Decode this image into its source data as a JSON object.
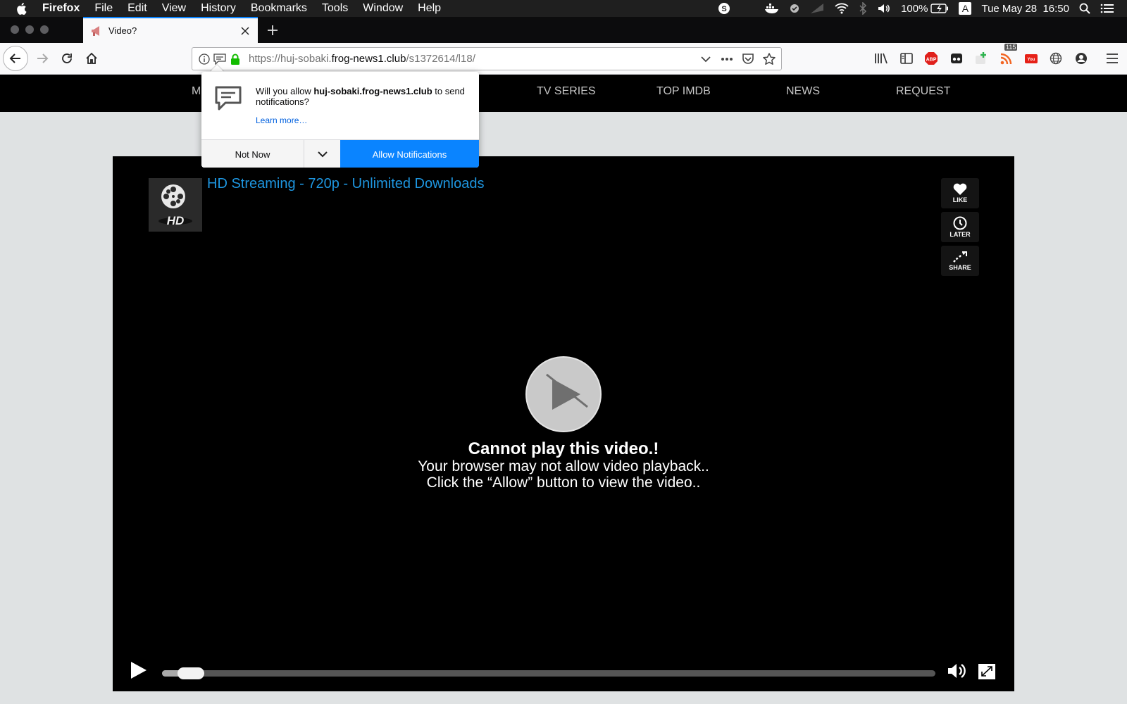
{
  "menubar": {
    "app": "Firefox",
    "items": [
      "File",
      "Edit",
      "View",
      "History",
      "Bookmarks",
      "Tools",
      "Window",
      "Help"
    ],
    "battery": "100%",
    "input_source": "A",
    "datetime": "Tue May 28  16:50"
  },
  "tab": {
    "title": "Video?"
  },
  "urlbar": {
    "url_prefix": "https://huj-sobaki.",
    "url_domain": "frog-news1.club",
    "url_suffix": "/s1372614/l18/"
  },
  "toolbar": {
    "rss_badge": "115"
  },
  "sitenav": {
    "partial_left": "M",
    "links": [
      "TV SERIES",
      "TOP IMDB",
      "NEWS",
      "REQUEST"
    ]
  },
  "popup": {
    "text_before": "Will you allow ",
    "site": "huj-sobaki.frog-news1.club",
    "text_after": " to send notifications?",
    "learn_more": "Learn more…",
    "not_now": "Not Now",
    "allow": "Allow Notifications"
  },
  "player": {
    "logo_text": "HD",
    "title": "HD Streaming - 720p - Unlimited Downloads",
    "side_buttons": [
      "LIKE",
      "LATER",
      "SHARE"
    ],
    "error_title": "Cannot play this video.!",
    "error_line1": "Your browser may not allow video playback..",
    "error_line2": "Click the “Allow” button to view the video..",
    "progress_fraction": 0.02
  }
}
